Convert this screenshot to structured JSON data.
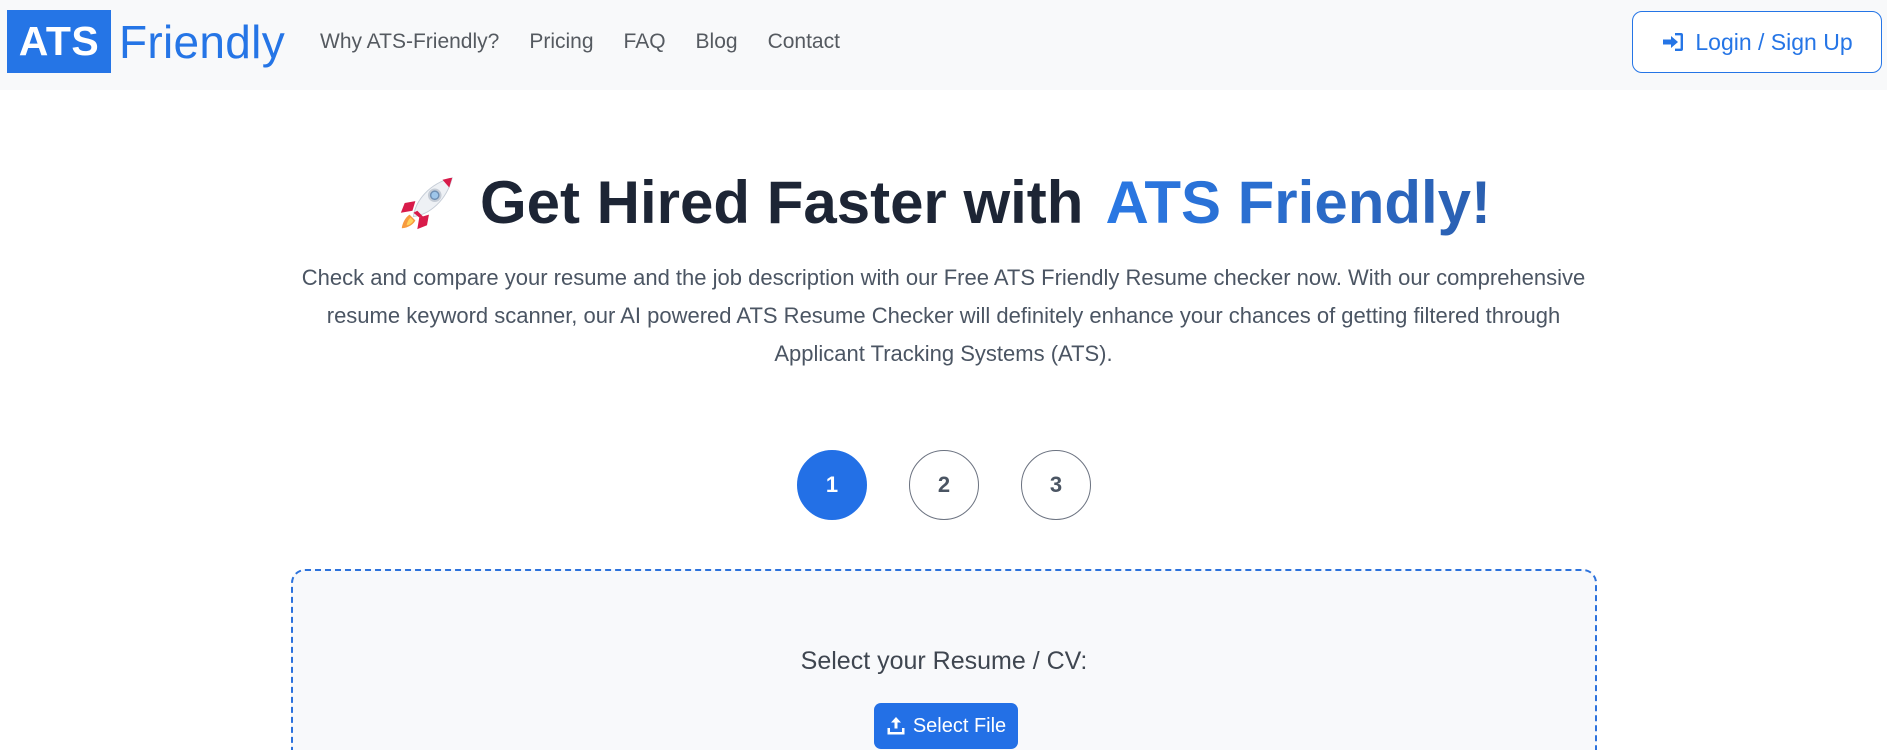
{
  "navbar": {
    "logo": {
      "box_text": "ATS",
      "text": "Friendly"
    },
    "links": [
      {
        "label": "Why ATS-Friendly?"
      },
      {
        "label": "Pricing"
      },
      {
        "label": "FAQ"
      },
      {
        "label": "Blog"
      },
      {
        "label": "Contact"
      }
    ],
    "login": {
      "label": "Login / Sign Up",
      "icon": "sign-in-icon"
    }
  },
  "hero": {
    "emoji": "rocket-icon",
    "title_main": "Get Hired Faster with",
    "title_accent": "ATS Friendly!",
    "description": "Check and compare your resume and the job description with our Free ATS Friendly Resume checker now. With our comprehensive resume keyword scanner, our AI powered ATS Resume Checker will definitely enhance your chances of getting filtered through Applicant Tracking Systems (ATS)."
  },
  "steps": [
    {
      "label": "1",
      "active": true
    },
    {
      "label": "2",
      "active": false
    },
    {
      "label": "3",
      "active": false
    }
  ],
  "upload": {
    "label": "Select your Resume / CV:",
    "button_label": "Select File",
    "button_icon": "upload-icon"
  },
  "colors": {
    "brand": "#2575e6",
    "nav_bg": "#f8f9fa",
    "title": "#1d2535",
    "text": "#4b5563"
  }
}
